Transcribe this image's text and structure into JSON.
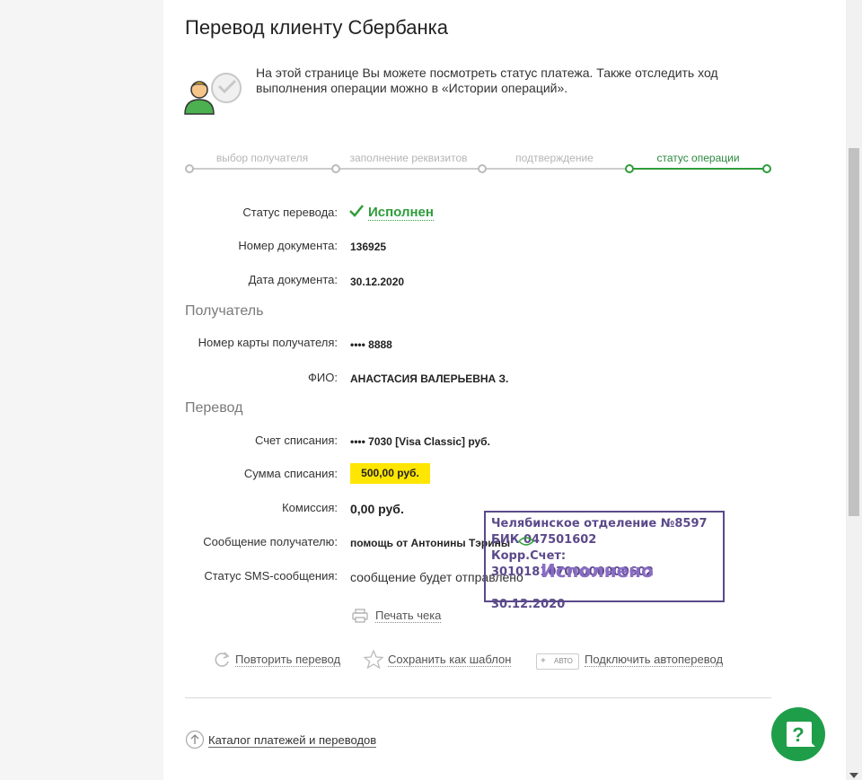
{
  "header": {
    "title": "Перевод клиенту Сбербанка"
  },
  "intro": {
    "text": "На этой странице Вы можете посмотреть статус платежа. Также отследить ход выполнения операции можно в «Истории операций»."
  },
  "steps": [
    {
      "label": "выбор получателя",
      "active": false
    },
    {
      "label": "заполнение реквизитов",
      "active": false
    },
    {
      "label": "подтверждение",
      "active": false
    },
    {
      "label": "статус операции",
      "active": true
    }
  ],
  "status": {
    "label": "Статус перевода:",
    "value": "Исполнен"
  },
  "doc_number": {
    "label": "Номер документа:",
    "value": "136925"
  },
  "doc_date": {
    "label": "Дата документа:",
    "value": "30.12.2020"
  },
  "recipient_section": "Получатель",
  "card_number": {
    "label": "Номер карты получателя:",
    "value": "•••• 8888"
  },
  "fio": {
    "label": "ФИО:",
    "value": "АНАСТАСИЯ ВАЛЕРЬЕВНА З."
  },
  "transfer_section": "Перевод",
  "debit_account": {
    "label": "Счет списания:",
    "value": "•••• 7030  [Visa Classic]  руб."
  },
  "debit_amount": {
    "label": "Сумма списания:",
    "value": "500,00  руб."
  },
  "commission": {
    "label": "Комиссия:",
    "value": "0,00 руб."
  },
  "message": {
    "label": "Сообщение получателю:",
    "value": "помощь от Антонины Тэрины"
  },
  "sms_status": {
    "label": "Статус SMS-сообщения:",
    "value": "сообщение будет отправлено"
  },
  "print_receipt": "Печать чека",
  "actions": {
    "repeat": "Повторить перевод",
    "save_template": "Сохранить как шаблон",
    "auto_badge": "АВТО",
    "auto_plus": "+",
    "auto_transfer": "Подключить автоперевод"
  },
  "catalog_link": "Каталог платежей и переводов",
  "stamp": {
    "line1": "Челябинское отделение №8597",
    "line2": "БИК 047501602",
    "line3": "Корр.Счет: 30101810700000000602",
    "big": "Исполнено",
    "date": "30.12.2020"
  },
  "colors": {
    "accent_green": "#2e9c3a",
    "highlight_yellow": "#ffe600",
    "stamp_purple": "#5b4a8a"
  },
  "icons": [
    "user-icon",
    "check-icon",
    "print-icon",
    "repeat-icon",
    "star-icon",
    "arrow-up-icon",
    "help-chat-icon"
  ]
}
